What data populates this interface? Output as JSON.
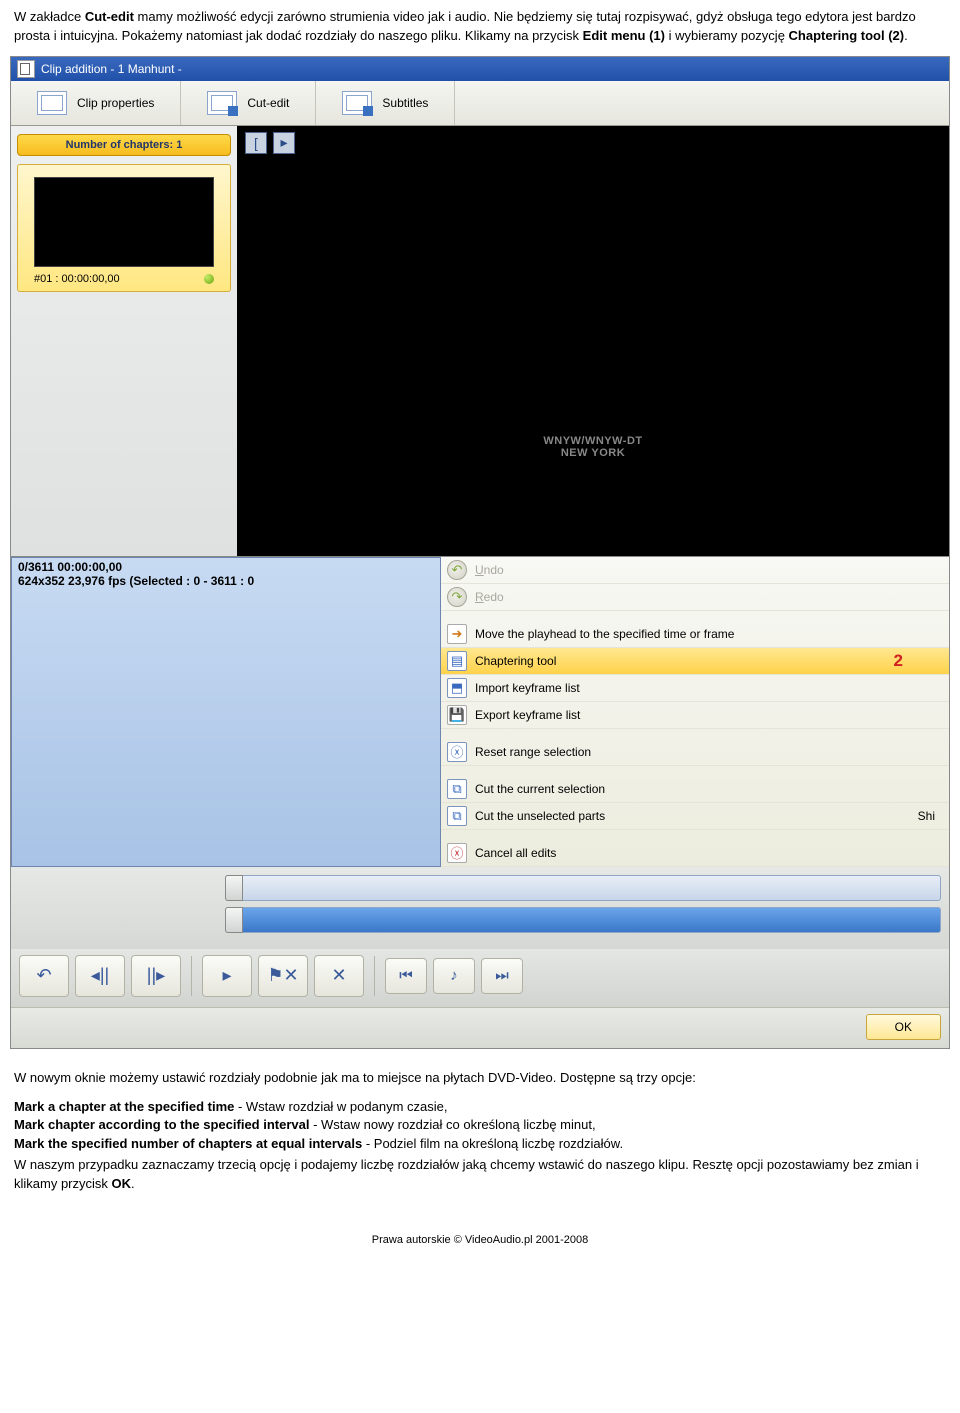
{
  "intro": {
    "p1a": "W zakładce ",
    "p1b": "Cut-edit",
    "p1c": " mamy możliwość edycji zarówno strumienia video jak i audio. Nie będziemy się tutaj rozpisywać, gdyż obsługa tego edytora jest bardzo prosta i intuicyjna. Pokażemy natomiast jak dodać rozdziały do naszego pliku. Klikamy na przycisk ",
    "p1d": "Edit menu (1)",
    "p1e": " i wybieramy pozycję ",
    "p1f": "Chaptering tool (2)",
    "p1g": "."
  },
  "window": {
    "title": "Clip addition - 1 Manhunt -"
  },
  "tabs": {
    "clipProps": "Clip properties",
    "cutEdit": "Cut-edit",
    "subtitles": "Subtitles"
  },
  "sidebar": {
    "chaptersLabel": "Number of chapters: 1",
    "thumbLabel": "#01 : 00:00:00,00"
  },
  "video": {
    "watermark1": "WNYW/WNYW-DT",
    "watermark2": "NEW YORK"
  },
  "info": {
    "line1": "0/3611  00:00:00,00",
    "line2": "624x352 23,976 fps (Selected : 0 - 3611 : 0"
  },
  "menu": {
    "undo_pre": "U",
    "undo": "ndo",
    "redo_pre": "R",
    "redo": "edo",
    "move": "Move the playhead to the specified time or frame",
    "chapter": "Chaptering tool",
    "importKf": "Import keyframe list",
    "exportKf": "Export keyframe list",
    "reset": "Reset range selection",
    "cutCur": "Cut the current selection",
    "cutUnsel": "Cut the unselected parts",
    "shi": "Shi",
    "cancel": "Cancel all edits",
    "anno": "2"
  },
  "ok": {
    "label": "OK"
  },
  "outro": {
    "p1": "W nowym oknie możemy ustawić rozdziały podobnie jak ma to miejsce na płytach DVD-Video. Dostępne są trzy opcje:",
    "o1a": "Mark a chapter at the specified time",
    "o1b": "  - Wstaw rozdział w podanym czasie,",
    "o2a": "Mark chapter according to the specified interval",
    "o2b": " - Wstaw nowy rozdział co określoną liczbę minut,",
    "o3a": "Mark the specified number of chapters at equal intervals",
    "o3b": "  - Podziel film na określoną liczbę rozdziałów.",
    "p2a": "W naszym przypadku zaznaczamy trzecią opcję i podajemy liczbę rozdziałów jaką chcemy wstawić do naszego klipu. Resztę opcji pozostawiamy bez zmian i klikamy przycisk ",
    "p2b": "OK",
    "p2c": "."
  },
  "footer": "Prawa autorskie © VideoAudio.pl 2001-2008"
}
